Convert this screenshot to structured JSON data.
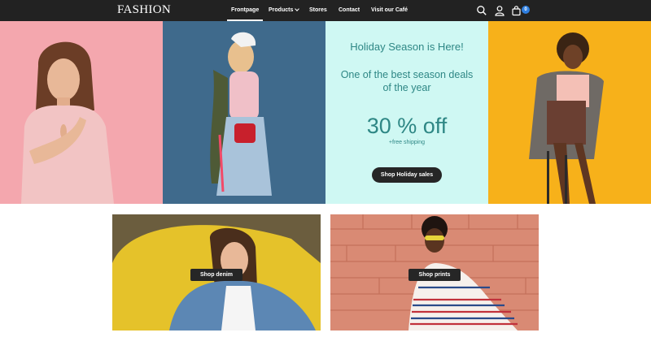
{
  "header": {
    "logo": "FASHION",
    "nav": [
      {
        "label": "Frontpage",
        "active": true
      },
      {
        "label": "Products",
        "has_dropdown": true
      },
      {
        "label": "Stores"
      },
      {
        "label": "Contact"
      },
      {
        "label": "Visit our Café"
      }
    ],
    "icons": [
      "search-icon",
      "user-icon",
      "cart-icon"
    ],
    "cart_count": "0"
  },
  "promo": {
    "headline": "Holiday Season is Here!",
    "subhead_line1": "One of the best season deals",
    "subhead_line2": "of the year",
    "offer": "30 % off",
    "shipping": "+free shipping",
    "cta": "Shop Holiday sales"
  },
  "cards": {
    "denim_cta": "Shop denim",
    "prints_cta": "Shop prints"
  },
  "colors": {
    "header_bg": "#222222",
    "panel_pink": "#f4a7ae",
    "panel_blue": "#3f6a8c",
    "panel_mint": "#cff8f3",
    "panel_yellow": "#f7b11a",
    "promo_text": "#2e8785",
    "button_dark": "#262626",
    "badge_blue": "#2f7fe0"
  }
}
